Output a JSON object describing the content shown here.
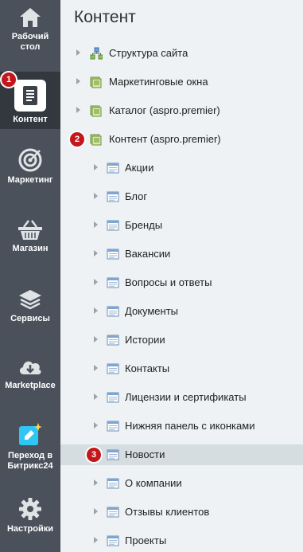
{
  "sidebar": {
    "items": [
      {
        "label_1": "Рабочий",
        "label_2": "стол",
        "icon": "home-icon"
      },
      {
        "label": "Контент",
        "icon": "document-icon",
        "active": true,
        "badge": "1"
      },
      {
        "label": "Маркетинг",
        "icon": "target-icon"
      },
      {
        "label": "Магазин",
        "icon": "basket-icon"
      },
      {
        "label": "Сервисы",
        "icon": "layers-icon"
      },
      {
        "label": "Marketplace",
        "icon": "cloud-download-icon"
      },
      {
        "label_1": "Переход в",
        "label_2": "Битрикс24",
        "icon": "bitrix24-icon"
      },
      {
        "label": "Настройки",
        "icon": "gear-icon"
      }
    ]
  },
  "main": {
    "title": "Контент",
    "tree": [
      {
        "label": "Структура сайта",
        "icon": "site-structure-icon"
      },
      {
        "label": "Маркетинговые окна",
        "icon": "folder-icon"
      },
      {
        "label": "Каталог (aspro.premier)",
        "icon": "folder-icon"
      },
      {
        "label": "Контент (aspro.premier)",
        "icon": "folder-icon",
        "badge": "2"
      },
      {
        "label": "Акции",
        "icon": "list-icon"
      },
      {
        "label": "Блог",
        "icon": "list-icon"
      },
      {
        "label": "Бренды",
        "icon": "list-icon"
      },
      {
        "label": "Вакансии",
        "icon": "list-icon"
      },
      {
        "label": "Вопросы и ответы",
        "icon": "list-icon"
      },
      {
        "label": "Документы",
        "icon": "list-icon"
      },
      {
        "label": "Истории",
        "icon": "list-icon"
      },
      {
        "label": "Контакты",
        "icon": "list-icon"
      },
      {
        "label": "Лицензии и сертификаты",
        "icon": "list-icon"
      },
      {
        "label": "Нижняя панель с иконками",
        "icon": "list-icon"
      },
      {
        "label": "Новости",
        "icon": "list-icon",
        "badge": "3",
        "selected": true
      },
      {
        "label": "О компании",
        "icon": "list-icon"
      },
      {
        "label": "Отзывы клиентов",
        "icon": "list-icon"
      },
      {
        "label": "Проекты",
        "icon": "list-icon"
      }
    ]
  },
  "colors": {
    "sidebar_bg": "#4a515b",
    "sidebar_active": "#33383f",
    "badge": "#c3171c",
    "main_bg": "#eef2f4",
    "selected_row": "#d5dde1"
  }
}
